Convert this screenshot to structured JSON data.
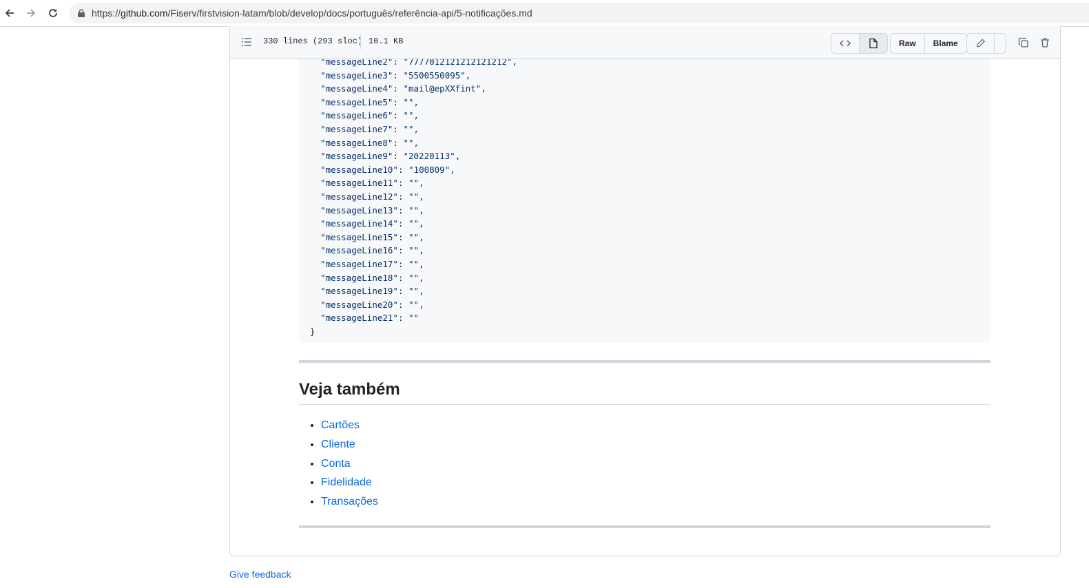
{
  "browser": {
    "url_prefix": "https://",
    "url_domain": "github.com",
    "url_path": "/Fiserv/firstvision-latam/blob/develop/docs/português/referência-api/5-notificações.md"
  },
  "file_header": {
    "lines_info": "330 lines (293 sloc)",
    "size": "10.1 KB",
    "raw_label": "Raw",
    "blame_label": "Blame"
  },
  "code_lines": [
    {
      "key": "\"messageLine2\"",
      "val": "\"7777012121212121212\","
    },
    {
      "key": "\"messageLine3\"",
      "val": "\"5500550095\","
    },
    {
      "key": "\"messageLine4\"",
      "val": "\"mail@epXXfint\","
    },
    {
      "key": "\"messageLine5\"",
      "val": "\"\","
    },
    {
      "key": "\"messageLine6\"",
      "val": "\"\","
    },
    {
      "key": "\"messageLine7\"",
      "val": "\"\","
    },
    {
      "key": "\"messageLine8\"",
      "val": "\"\","
    },
    {
      "key": "\"messageLine9\"",
      "val": "\"20220113\","
    },
    {
      "key": "\"messageLine10\"",
      "val": "\"100809\","
    },
    {
      "key": "\"messageLine11\"",
      "val": "\"\","
    },
    {
      "key": "\"messageLine12\"",
      "val": "\"\","
    },
    {
      "key": "\"messageLine13\"",
      "val": "\"\","
    },
    {
      "key": "\"messageLine14\"",
      "val": "\"\","
    },
    {
      "key": "\"messageLine15\"",
      "val": "\"\","
    },
    {
      "key": "\"messageLine16\"",
      "val": "\"\","
    },
    {
      "key": "\"messageLine17\"",
      "val": "\"\","
    },
    {
      "key": "\"messageLine18\"",
      "val": "\"\","
    },
    {
      "key": "\"messageLine19\"",
      "val": "\"\","
    },
    {
      "key": "\"messageLine20\"",
      "val": "\"\","
    },
    {
      "key": "\"messageLine21\"",
      "val": "\"\""
    }
  ],
  "closing_brace": "}",
  "section": {
    "heading": "Veja também",
    "links": [
      "Cartões",
      "Cliente",
      "Conta",
      "Fidelidade",
      "Transações"
    ]
  },
  "footer": {
    "feedback": "Give feedback"
  }
}
